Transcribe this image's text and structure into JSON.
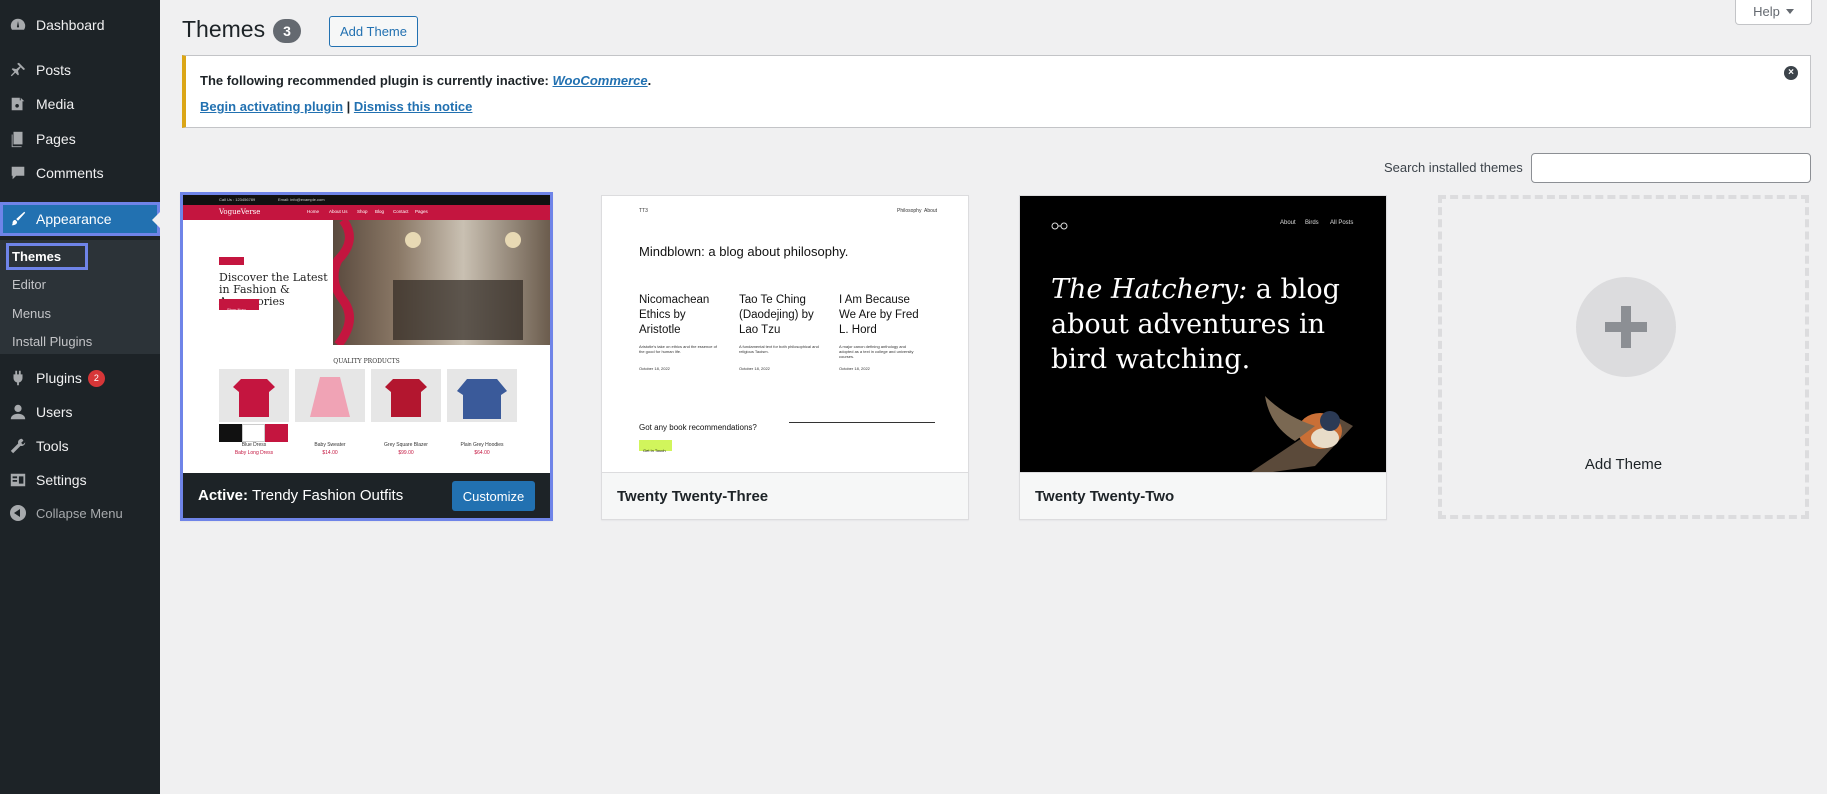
{
  "sidebar": {
    "items": [
      {
        "label": "Dashboard",
        "icon": "dashboard-icon"
      },
      {
        "label": "Posts",
        "icon": "pushpin-icon"
      },
      {
        "label": "Media",
        "icon": "media-icon"
      },
      {
        "label": "Pages",
        "icon": "pages-icon"
      },
      {
        "label": "Comments",
        "icon": "comments-icon"
      },
      {
        "label": "Appearance",
        "icon": "brush-icon"
      },
      {
        "label": "Plugins",
        "icon": "plugin-icon",
        "badge": "2"
      },
      {
        "label": "Users",
        "icon": "users-icon"
      },
      {
        "label": "Tools",
        "icon": "wrench-icon"
      },
      {
        "label": "Settings",
        "icon": "settings-icon"
      },
      {
        "label": "Collapse Menu",
        "icon": "collapse-icon"
      }
    ],
    "submenu": [
      "Themes",
      "Editor",
      "Menus",
      "Install Plugins"
    ]
  },
  "header": {
    "title": "Themes",
    "count": "3",
    "add_theme": "Add Theme",
    "help": "Help"
  },
  "notice": {
    "text": "The following recommended plugin is currently inactive:",
    "plugin_link": "WooCommerce",
    "period": ".",
    "begin_link": "Begin activating plugin",
    "separator": "|",
    "dismiss_link": "Dismiss this notice",
    "close": "×"
  },
  "search": {
    "label": "Search installed themes",
    "value": ""
  },
  "themes": {
    "active": {
      "prefix": "Active:",
      "name": "Trendy Fashion Outfits",
      "customize": "Customize",
      "preview": {
        "brand": "VogueVerse",
        "phone": "Call Us : 123456789",
        "email": "Email: info@example.com",
        "nav": [
          "Home",
          "About Us",
          "Shop",
          "Blog",
          "Contact",
          "Pages"
        ],
        "tag": "Offers",
        "headline": "Discover the Latest in Fashion & Accessories",
        "button": "Shop Now",
        "section": "QUALITY PRODUCTS",
        "products": [
          "Blue Dress",
          "Baby Sweater",
          "Grey Square Blazer",
          "Plain Grey Hoodies"
        ],
        "prices": [
          "Baby Long Dress",
          "$14.00",
          "$99.00",
          "$64.00"
        ]
      }
    },
    "tt3": {
      "name": "Twenty Twenty-Three",
      "preview": {
        "site": "TT3",
        "nav": [
          "Philosophy",
          "About"
        ],
        "heading": "Mindblown: a blog about philosophy.",
        "posts": [
          {
            "title": "Nicomachean Ethics by Aristotle",
            "excerpt": "Aristotle's take on ethics and the essence of the good for human life.",
            "date": "October 18, 2022"
          },
          {
            "title": "Tao Te Ching (Daodejing) by Lao Tzu",
            "excerpt": "A fundamental text for both philosophical and religious Taoism.",
            "date": "October 18, 2022"
          },
          {
            "title": "I Am Because We Are by Fred L. Hord",
            "excerpt": "A major canon defining anthology and adopted as a text in college and university courses.",
            "date": "October 18, 2022"
          }
        ],
        "question": "Got any book recommendations?",
        "button": "Get In Touch"
      }
    },
    "tt2": {
      "name": "Twenty Twenty-Two",
      "preview": {
        "title_italic": "The Hatchery:",
        "title_rest": " a blog about adventures in bird watching.",
        "nav": [
          "About",
          "Birds",
          "All Posts"
        ]
      }
    }
  },
  "add_card": {
    "label": "Add Theme"
  },
  "colors": {
    "sidebar_bg": "#1d2327",
    "accent": "#2271b1",
    "notice_border": "#dba617",
    "plugin_badge": "#d63638",
    "focus_outline": "#6f84e8",
    "fashion_red": "#c4153f",
    "tt3_button": "#d1f55c"
  }
}
